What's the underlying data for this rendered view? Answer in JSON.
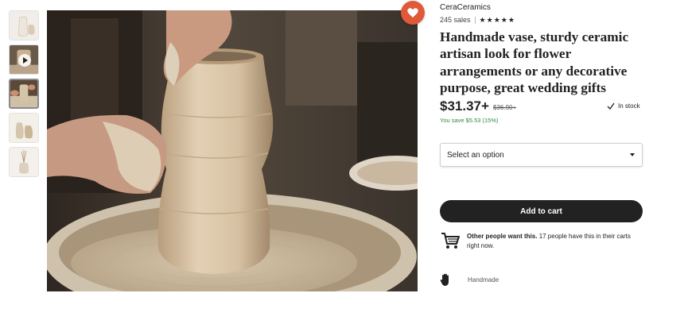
{
  "thumbnails": [
    {
      "name": "thumb-vases-1",
      "icon": "vase-photo"
    },
    {
      "name": "thumb-video",
      "icon": "play-icon"
    },
    {
      "name": "thumb-wheel",
      "icon": "pottery-photo"
    },
    {
      "name": "thumb-vases-2",
      "icon": "vase-photo"
    },
    {
      "name": "thumb-vase-stems",
      "icon": "vase-photo"
    }
  ],
  "main_image": {
    "subject": "vase being thrown on pottery wheel"
  },
  "favorite": {
    "icon": "heart-icon",
    "color": "#e05a3a"
  },
  "listing": {
    "shop_name": "CeraCeramics",
    "sales": "245 sales",
    "rating_stars": 5,
    "title": "Handmade vase, sturdy ceramic artisan look for flower arrangements or any decorative purpose, great wedding gifts",
    "price": "$31.37+",
    "original_price": "$36.90+",
    "stock": "In stock",
    "savings": "You save $5.53 (15%)",
    "select_placeholder": "Select an option",
    "add_to_cart": "Add to cart",
    "demand_bold": "Other people want this.",
    "demand_text": "17 people have this in their carts right now.",
    "handmade": "Handmade"
  },
  "colors": {
    "accent": "#e05a3a",
    "savings_green": "#2e8b3e",
    "button_dark": "#222222"
  }
}
